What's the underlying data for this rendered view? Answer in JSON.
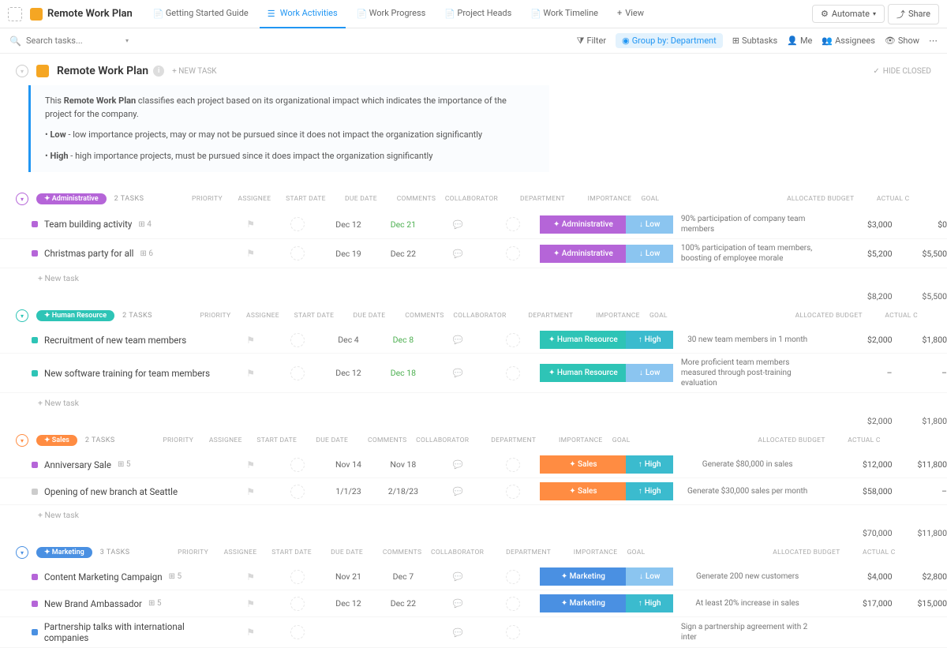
{
  "top": {
    "space_title": "Remote Work Plan",
    "tabs": [
      {
        "label": "Getting Started Guide"
      },
      {
        "label": "Work Activities"
      },
      {
        "label": "Work Progress"
      },
      {
        "label": "Project Heads"
      },
      {
        "label": "Work Timeline"
      }
    ],
    "view_btn": "View",
    "automate": "Automate",
    "share": "Share"
  },
  "toolbar": {
    "search_placeholder": "Search tasks...",
    "filter": "Filter",
    "group_by": "Group by: Department",
    "subtasks": "Subtasks",
    "me": "Me",
    "assignees": "Assignees",
    "show": "Show"
  },
  "header": {
    "title": "Remote Work Plan",
    "new_task": "+ NEW TASK",
    "hide_closed": "HIDE CLOSED"
  },
  "description": {
    "p1": "This Remote Work Plan classifies each project based on its organizational impact which indicates the importance of the project for the company.",
    "p2_label": "Low",
    "p2_text": " - low importance projects, may or may not be pursued since it does not impact the organization significantly",
    "p3_label": "High",
    "p3_text": " - high importance projects, must be pursued since it does impact the organization significantly"
  },
  "columns": {
    "priority": "PRIORITY",
    "assignee": "ASSIGNEE",
    "start": "START DATE",
    "due": "DUE DATE",
    "comments": "COMMENTS",
    "collab": "COLLABORATOR",
    "dept": "DEPARTMENT",
    "imp": "IMPORTANCE",
    "goal": "GOAL",
    "budget": "ALLOCATED BUDGET",
    "actual": "ACTUAL C"
  },
  "groups": [
    {
      "name": "Administrative",
      "pill_class": "admin",
      "sq": "sq-purple",
      "count": "2 TASKS",
      "tasks": [
        {
          "name": "Team building activity",
          "sub": "4",
          "start": "Dec 12",
          "due": "Dec 21",
          "due_cls": "date-green",
          "dept": "Administrative",
          "dept_cls": "dept-admin",
          "imp": "Low",
          "imp_cls": "imp-low",
          "goal": "90% participation of company team members",
          "budget": "$3,000",
          "actual": "$0"
        },
        {
          "name": "Christmas party for all",
          "sub": "6",
          "start": "Dec 19",
          "due": "Dec 22",
          "due_cls": "",
          "dept": "Administrative",
          "dept_cls": "dept-admin",
          "imp": "Low",
          "imp_cls": "imp-low",
          "goal": "100% participation of team members, boosting of employee morale",
          "budget": "$5,200",
          "actual": "$5,500"
        }
      ],
      "footer_budget": "$8,200",
      "footer_actual": "$5,500"
    },
    {
      "name": "Human Resource",
      "pill_class": "hr",
      "sq": "sq-teal",
      "count": "2 TASKS",
      "tasks": [
        {
          "name": "Recruitment of new team members",
          "sub": "",
          "start": "Dec 4",
          "due": "Dec 8",
          "due_cls": "date-green",
          "dept": "Human Resource",
          "dept_cls": "dept-hr",
          "imp": "High",
          "imp_cls": "imp-high",
          "goal": "30 new team members in 1 month",
          "budget": "$2,000",
          "actual": "$1,800"
        },
        {
          "name": "New software training for team members",
          "sub": "",
          "start": "Dec 12",
          "due": "Dec 18",
          "due_cls": "date-green",
          "dept": "Human Resource",
          "dept_cls": "dept-hr",
          "imp": "Low",
          "imp_cls": "imp-low",
          "goal": "More proficient team members measured through post-training evaluation",
          "budget": "–",
          "actual": "–"
        }
      ],
      "footer_budget": "$2,000",
      "footer_actual": "$1,800"
    },
    {
      "name": "Sales",
      "pill_class": "sales",
      "sq": "sq-grey",
      "count": "2 TASKS",
      "tasks": [
        {
          "name": "Anniversary Sale",
          "sub": "5",
          "sq_override": "sq-purple",
          "start": "Nov 14",
          "due": "Nov 18",
          "due_cls": "",
          "dept": "Sales",
          "dept_cls": "dept-sales",
          "imp": "High",
          "imp_cls": "imp-high",
          "goal": "Generate $80,000 in sales",
          "budget": "$12,000",
          "actual": "$11,800"
        },
        {
          "name": "Opening of new branch at Seattle",
          "sub": "",
          "start": "1/1/23",
          "due": "2/18/23",
          "due_cls": "",
          "dept": "Sales",
          "dept_cls": "dept-sales",
          "imp": "High",
          "imp_cls": "imp-high",
          "goal": "Generate $30,000 sales per month",
          "budget": "$58,000",
          "actual": "–"
        }
      ],
      "footer_budget": "$70,000",
      "footer_actual": "$11,800"
    },
    {
      "name": "Marketing",
      "pill_class": "marketing",
      "sq": "sq-blue",
      "count": "3 TASKS",
      "tasks": [
        {
          "name": "Content Marketing Campaign",
          "sub": "5",
          "sq_override": "sq-purple",
          "start": "Nov 21",
          "due": "Dec 7",
          "due_cls": "",
          "dept": "Marketing",
          "dept_cls": "dept-marketing",
          "imp": "Low",
          "imp_cls": "imp-low",
          "goal": "Generate 200 new customers",
          "budget": "$4,000",
          "actual": "$2,800"
        },
        {
          "name": "New Brand Ambassador",
          "sub": "5",
          "sq_override": "sq-purple",
          "start": "Dec 12",
          "due": "Dec 22",
          "due_cls": "",
          "dept": "Marketing",
          "dept_cls": "dept-marketing",
          "imp": "High",
          "imp_cls": "imp-high",
          "goal": "At least 20% increase in sales",
          "budget": "$17,000",
          "actual": "$15,000"
        },
        {
          "name": "Partnership talks with international companies",
          "sub": "",
          "start": "",
          "due": "",
          "due_cls": "",
          "dept": "",
          "dept_cls": "",
          "imp": "",
          "imp_cls": "",
          "goal": "Sign a partnership agreement with 2 inter",
          "budget": "",
          "actual": ""
        }
      ],
      "no_footer": true
    }
  ],
  "new_task_label": "+ New task"
}
